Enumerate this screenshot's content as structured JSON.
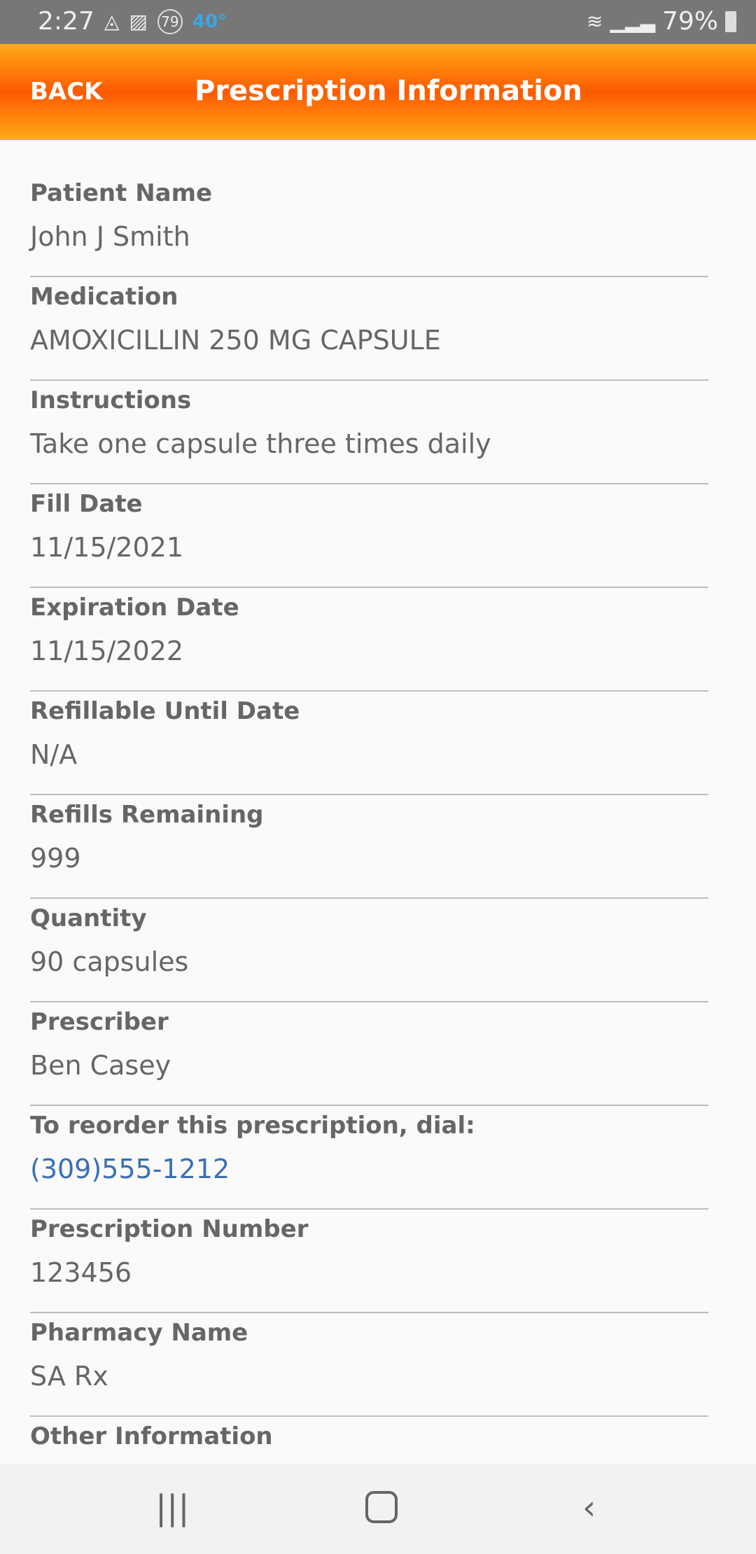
{
  "status_bar": {
    "time": "2:27",
    "temperature": "40°",
    "badge": "79",
    "battery": "79%",
    "icons": [
      "navigation-icon",
      "image-icon",
      "badge-79-icon",
      "wifi-icon",
      "signal-icon",
      "battery-icon"
    ]
  },
  "header": {
    "back_label": "BACK",
    "title": "Prescription Information",
    "gradient_colors": [
      "#ffaa1a",
      "#fc5a00"
    ]
  },
  "fields": [
    {
      "label": "Patient Name",
      "value": "John J Smith"
    },
    {
      "label": "Medication",
      "value": "AMOXICILLIN 250 MG CAPSULE"
    },
    {
      "label": "Instructions",
      "value": "Take one capsule three times daily"
    },
    {
      "label": "Fill Date",
      "value": "11/15/2021"
    },
    {
      "label": "Expiration Date",
      "value": "11/15/2022"
    },
    {
      "label": "Refillable Until Date",
      "value": "N/A"
    },
    {
      "label": "Refills Remaining",
      "value": "999"
    },
    {
      "label": "Quantity",
      "value": "90 capsules"
    },
    {
      "label": "Prescriber",
      "value": "Ben Casey"
    },
    {
      "label": "To reorder this prescription, dial:",
      "value": "(309)555-1212"
    },
    {
      "label": "Prescription Number",
      "value": "123456"
    },
    {
      "label": "Pharmacy Name",
      "value": "SA Rx"
    },
    {
      "label": "Other Information",
      "value": ""
    }
  ],
  "link_color": "#3a6fb5",
  "nav": {
    "recents": "recents-icon",
    "home": "home-icon",
    "back": "back-icon"
  }
}
